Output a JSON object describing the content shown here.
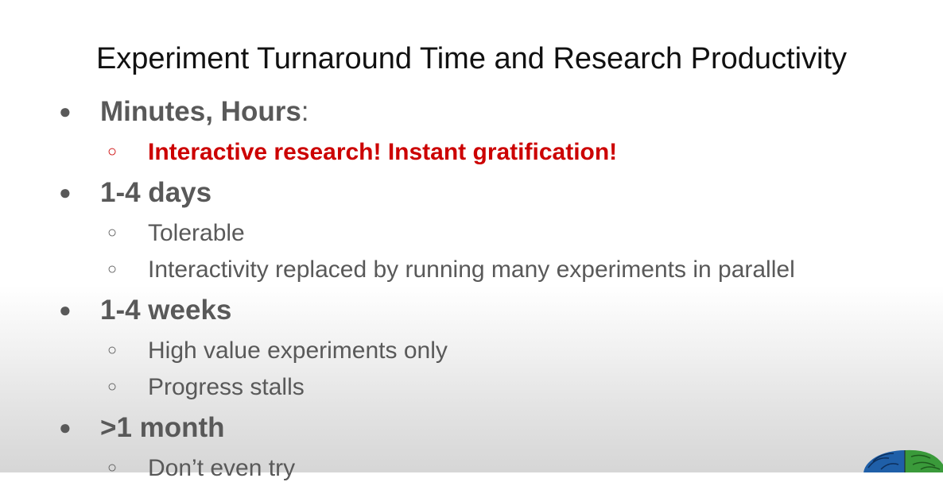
{
  "slide": {
    "title": "Experiment Turnaround Time and Research Productivity",
    "bullets": [
      {
        "heading": "Minutes, Hours",
        "suffix": ":",
        "subs": [
          "Interactive research!  Instant gratification!"
        ]
      },
      {
        "heading": "1-4 days",
        "subs": [
          "Tolerable",
          "Interactivity replaced by running many experiments in parallel"
        ]
      },
      {
        "heading": "1-4 weeks",
        "subs": [
          "High value experiments only",
          "Progress stalls"
        ]
      },
      {
        "heading": ">1 month",
        "subs": [
          "Don’t even try"
        ]
      }
    ],
    "bullet_glyphs": {
      "level1": "●",
      "level2": "○"
    },
    "logo_icon": "brain-logo-icon",
    "colors": {
      "highlight": "#cc0000",
      "text": "#595959",
      "title": "#111111",
      "logo_blue": "#1f5fa8",
      "logo_green": "#3a9a3a"
    }
  }
}
